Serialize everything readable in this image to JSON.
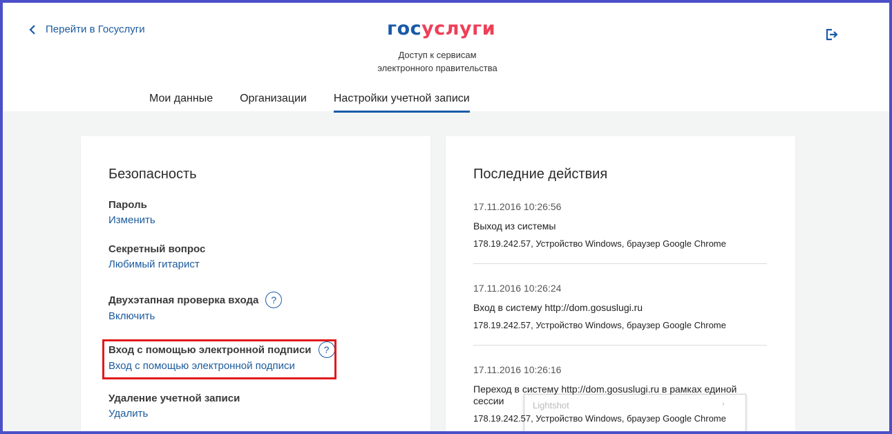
{
  "header": {
    "back_link": "Перейти в Госуслуги",
    "logo": {
      "part1": "гос",
      "part2": "услуги"
    },
    "subtitle_line1": "Доступ к сервисам",
    "subtitle_line2": "электронного правительства",
    "tabs": [
      {
        "label": "Мои данные",
        "active": false
      },
      {
        "label": "Организации",
        "active": false
      },
      {
        "label": "Настройки учетной записи",
        "active": true
      }
    ]
  },
  "security": {
    "title": "Безопасность",
    "items": [
      {
        "label": "Пароль",
        "link": "Изменить"
      },
      {
        "label": "Секретный вопрос",
        "link": "Любимый гитарист"
      },
      {
        "label": "Двухэтапная проверка входа",
        "link": "Включить"
      },
      {
        "label": "Вход с помощью электронной подписи",
        "link": "Вход с помощью электронной подписи"
      },
      {
        "label": "Удаление учетной записи",
        "link": "Удалить"
      }
    ]
  },
  "recent": {
    "title": "Последние действия",
    "entries": [
      {
        "date": "17.11.2016 10:26:56",
        "action": "Выход из системы",
        "device": "178.19.242.57, Устройство Windows, браузер Google Chrome"
      },
      {
        "date": "17.11.2016 10:26:24",
        "action": "Вход в систему http://dom.gosuslugi.ru",
        "device": "178.19.242.57, Устройство Windows, браузер Google Chrome"
      },
      {
        "date": "17.11.2016 10:26:16",
        "action": "Переход в систему http://dom.gosuslugi.ru в рамках единой сессии",
        "device": "178.19.242.57, Устройство Windows, браузер Google Chrome"
      }
    ]
  },
  "popup": {
    "ghost_text": "Lightshot"
  },
  "colors": {
    "accent": "#1a5aa8",
    "logo_red": "#ee3f58",
    "highlight": "#e01b1b",
    "frame": "#4b4fc8"
  }
}
